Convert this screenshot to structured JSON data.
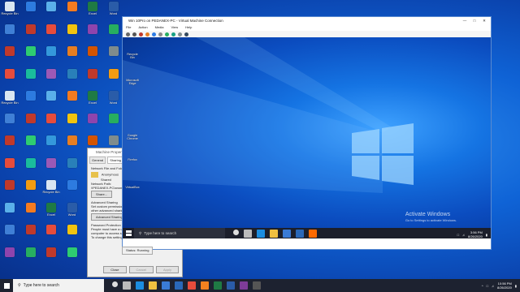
{
  "host_desktop": {
    "icons": [
      {
        "label": "Recycle Bin",
        "color": "#d9e6f2"
      },
      {
        "label": "",
        "color": "#2d7be0"
      },
      {
        "label": "",
        "color": "#5ab0ea"
      },
      {
        "label": "",
        "color": "#f47b20"
      },
      {
        "label": "Excel",
        "color": "#1f7a44"
      },
      {
        "label": "Word",
        "color": "#2a5ca8"
      },
      {
        "label": "",
        "color": "#3f7fd6"
      },
      {
        "label": "",
        "color": "#c0392b"
      },
      {
        "label": "",
        "color": "#e74c3c"
      },
      {
        "label": "",
        "color": "#f1c40f"
      },
      {
        "label": "",
        "color": "#8e44ad"
      },
      {
        "label": "",
        "color": "#27ae60"
      },
      {
        "label": "",
        "color": "#c0392b"
      },
      {
        "label": "",
        "color": "#2ecc71"
      },
      {
        "label": "",
        "color": "#3498db"
      },
      {
        "label": "",
        "color": "#e67e22"
      },
      {
        "label": "",
        "color": "#d35400"
      },
      {
        "label": "",
        "color": "#7f8c8d"
      },
      {
        "label": "",
        "color": "#e74c3c"
      },
      {
        "label": "",
        "color": "#1abc9c"
      },
      {
        "label": "",
        "color": "#9b59b6"
      },
      {
        "label": "",
        "color": "#2980b9"
      },
      {
        "label": "",
        "color": "#c0392b"
      },
      {
        "label": "",
        "color": "#f39c12"
      }
    ],
    "taskbar": {
      "search_placeholder": "Type here to search",
      "time": "10:56 PM",
      "date": "8/26/2020"
    }
  },
  "machine_properties": {
    "title": "Machine Properties",
    "tabs": [
      "General",
      "Sharing",
      "Security"
    ],
    "active_tab": "Sharing",
    "sections": {
      "network_heading": "Network File and Folder Sharing",
      "share_name": "Anonymous",
      "share_state": "Shared",
      "network_path_label": "Network Path:",
      "network_path": "\\\\PEDANEX-PC\\anonymous",
      "share_button": "Share...",
      "advanced_heading": "Advanced Sharing",
      "advanced_desc": "Set custom permissions, create multiple shares, and set other advanced sharing options.",
      "advanced_button": "Advanced Sharing...",
      "password_heading": "Password Protection",
      "password_desc": "People must have a user account and password for this computer to access shared folders.",
      "password_link_prefix": "To change this setting, use the",
      "password_link": "Network and Sharing Center"
    },
    "buttons": {
      "close": "Close",
      "cancel": "Cancel",
      "apply": "Apply"
    }
  },
  "vm_window": {
    "title": "Win 10Pro on PEDANEX-PC - Virtual Machine Connection",
    "menu": [
      "File",
      "Action",
      "Media",
      "View",
      "Help"
    ],
    "guest_desktop": {
      "icons": [
        {
          "label": "Recycle Bin",
          "color": "#d7e3ef"
        },
        {
          "label": "Microsoft Edge",
          "color": "#1b8de0"
        },
        {
          "label": "Google Chrome",
          "color": "#e74c3c"
        },
        {
          "label": "Firefox",
          "color": "#f5821f"
        },
        {
          "label": "VirtualBox",
          "color": "#2a68b8"
        }
      ],
      "activate_title": "Activate Windows",
      "activate_sub": "Go to Settings to activate Windows.",
      "taskbar": {
        "search_placeholder": "Type here to search",
        "time": "3:56 PM",
        "date": "8/26/2020"
      }
    },
    "status_bar": "Status: Running"
  }
}
